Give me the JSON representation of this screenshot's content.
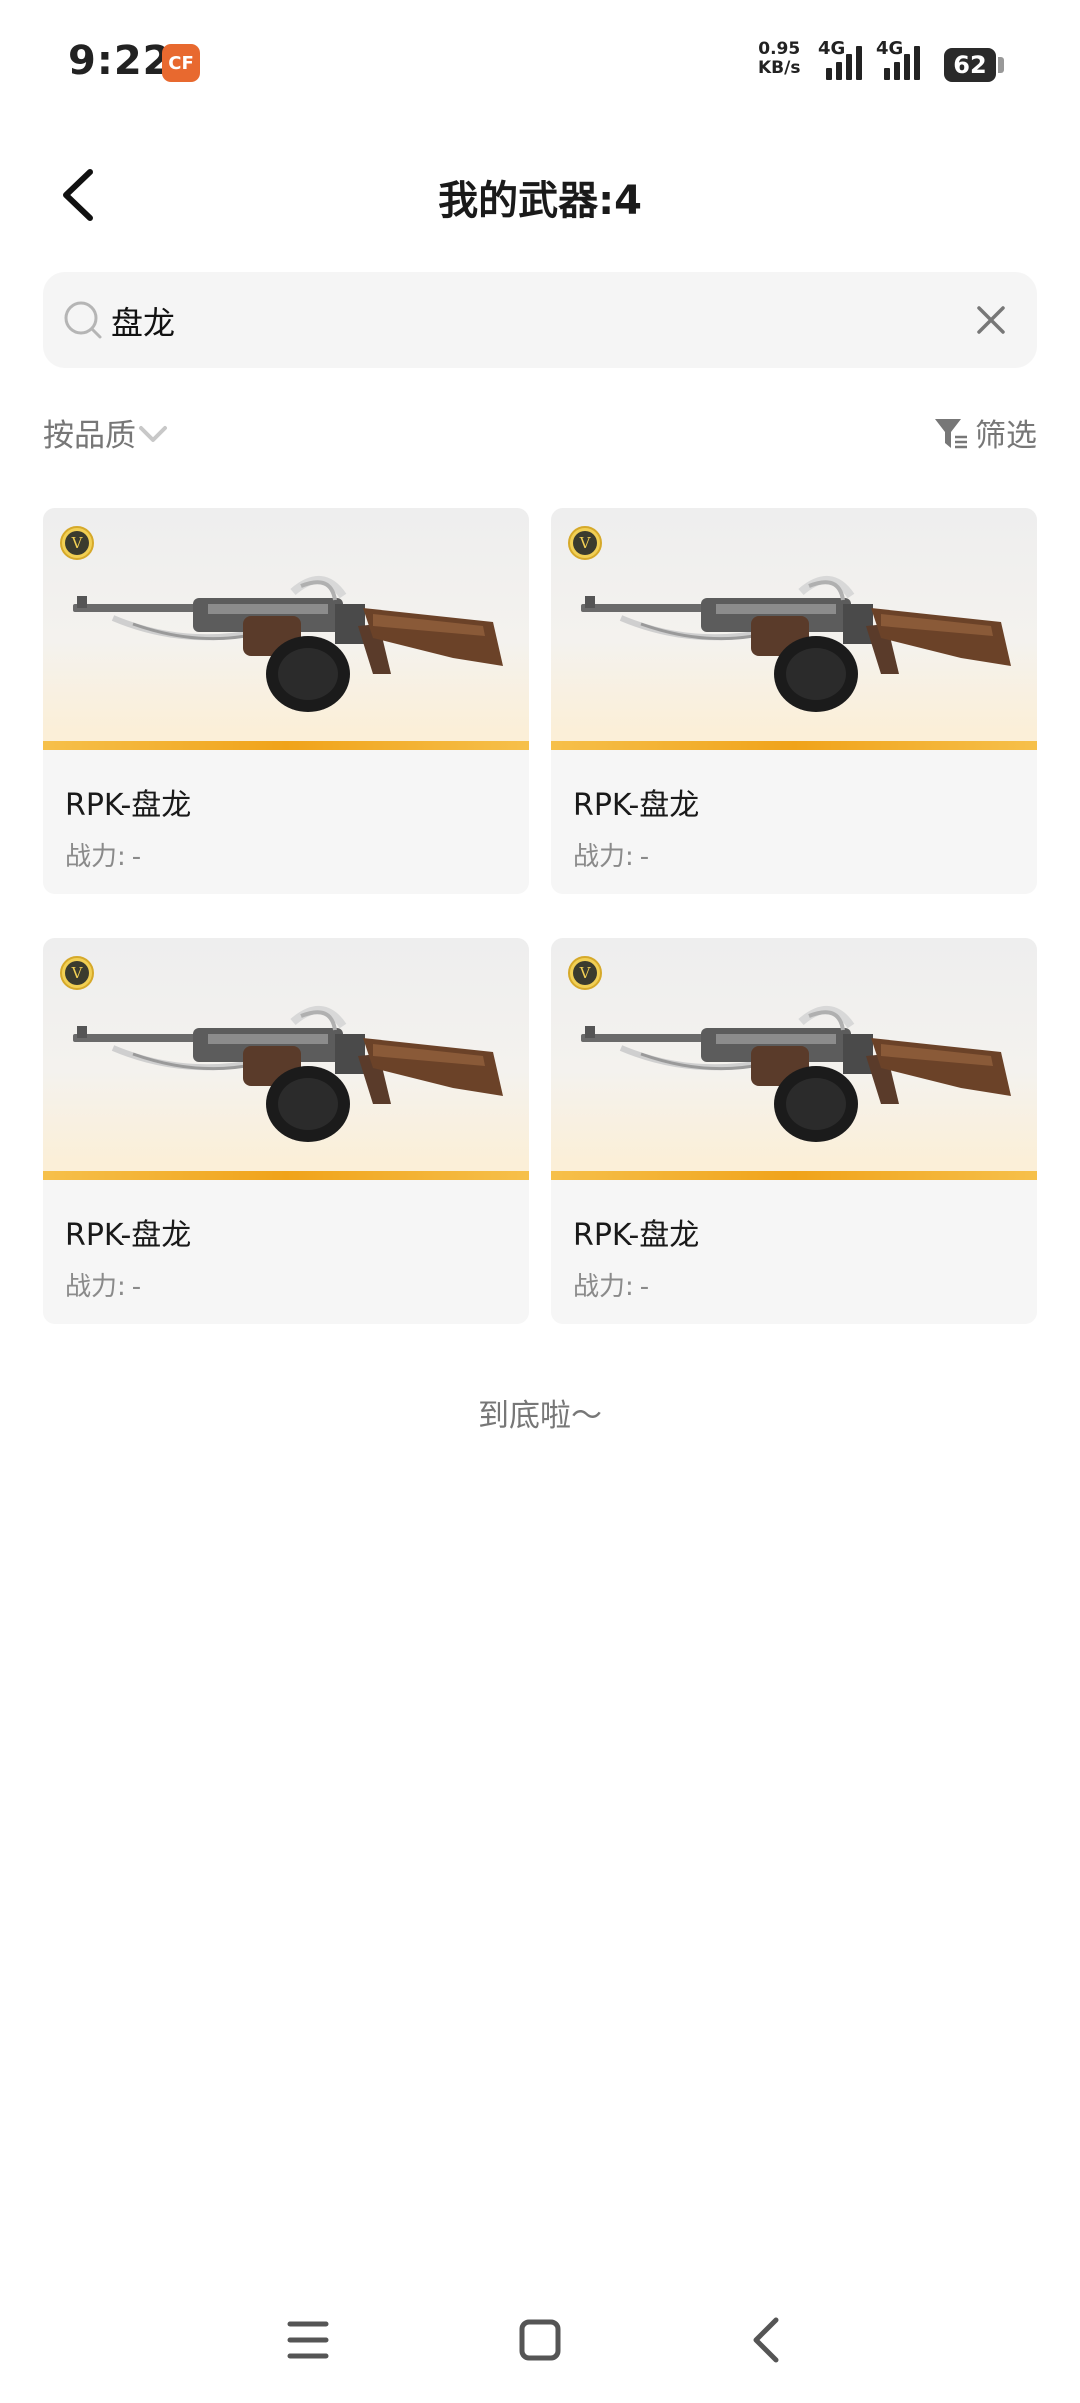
{
  "status_bar": {
    "time": "9:22",
    "app_icon_text": "CF",
    "net_speed_value": "0.95",
    "net_speed_unit": "KB/s",
    "sim1_label": "4G",
    "sim2_label": "4G",
    "battery_level": "62"
  },
  "header": {
    "title": "我的武器:4"
  },
  "search": {
    "value": "盘龙",
    "placeholder": ""
  },
  "filters": {
    "sort_label": "按品质",
    "filter_label": "筛选"
  },
  "weapons": [
    {
      "name": "RPK-盘龙",
      "power_label": "战力:",
      "power_value": "-",
      "badge": "V"
    },
    {
      "name": "RPK-盘龙",
      "power_label": "战力:",
      "power_value": "-",
      "badge": "V"
    },
    {
      "name": "RPK-盘龙",
      "power_label": "战力:",
      "power_value": "-",
      "badge": "V"
    },
    {
      "name": "RPK-盘龙",
      "power_label": "战力:",
      "power_value": "-",
      "badge": "V"
    }
  ],
  "footer": {
    "end_text": "到底啦～"
  },
  "icons": {
    "back": "chevron-left-icon",
    "search": "search-icon",
    "clear": "close-icon",
    "sort": "chevron-down-icon",
    "filter": "filter-icon",
    "nav_menu": "menu-icon",
    "nav_home": "home-icon",
    "nav_back": "back-icon"
  },
  "colors": {
    "accent_bar": "#f0a31a",
    "badge_gold": "#f1cf54",
    "card_bg": "#f6f6f6",
    "search_bg": "#f5f5f5"
  }
}
